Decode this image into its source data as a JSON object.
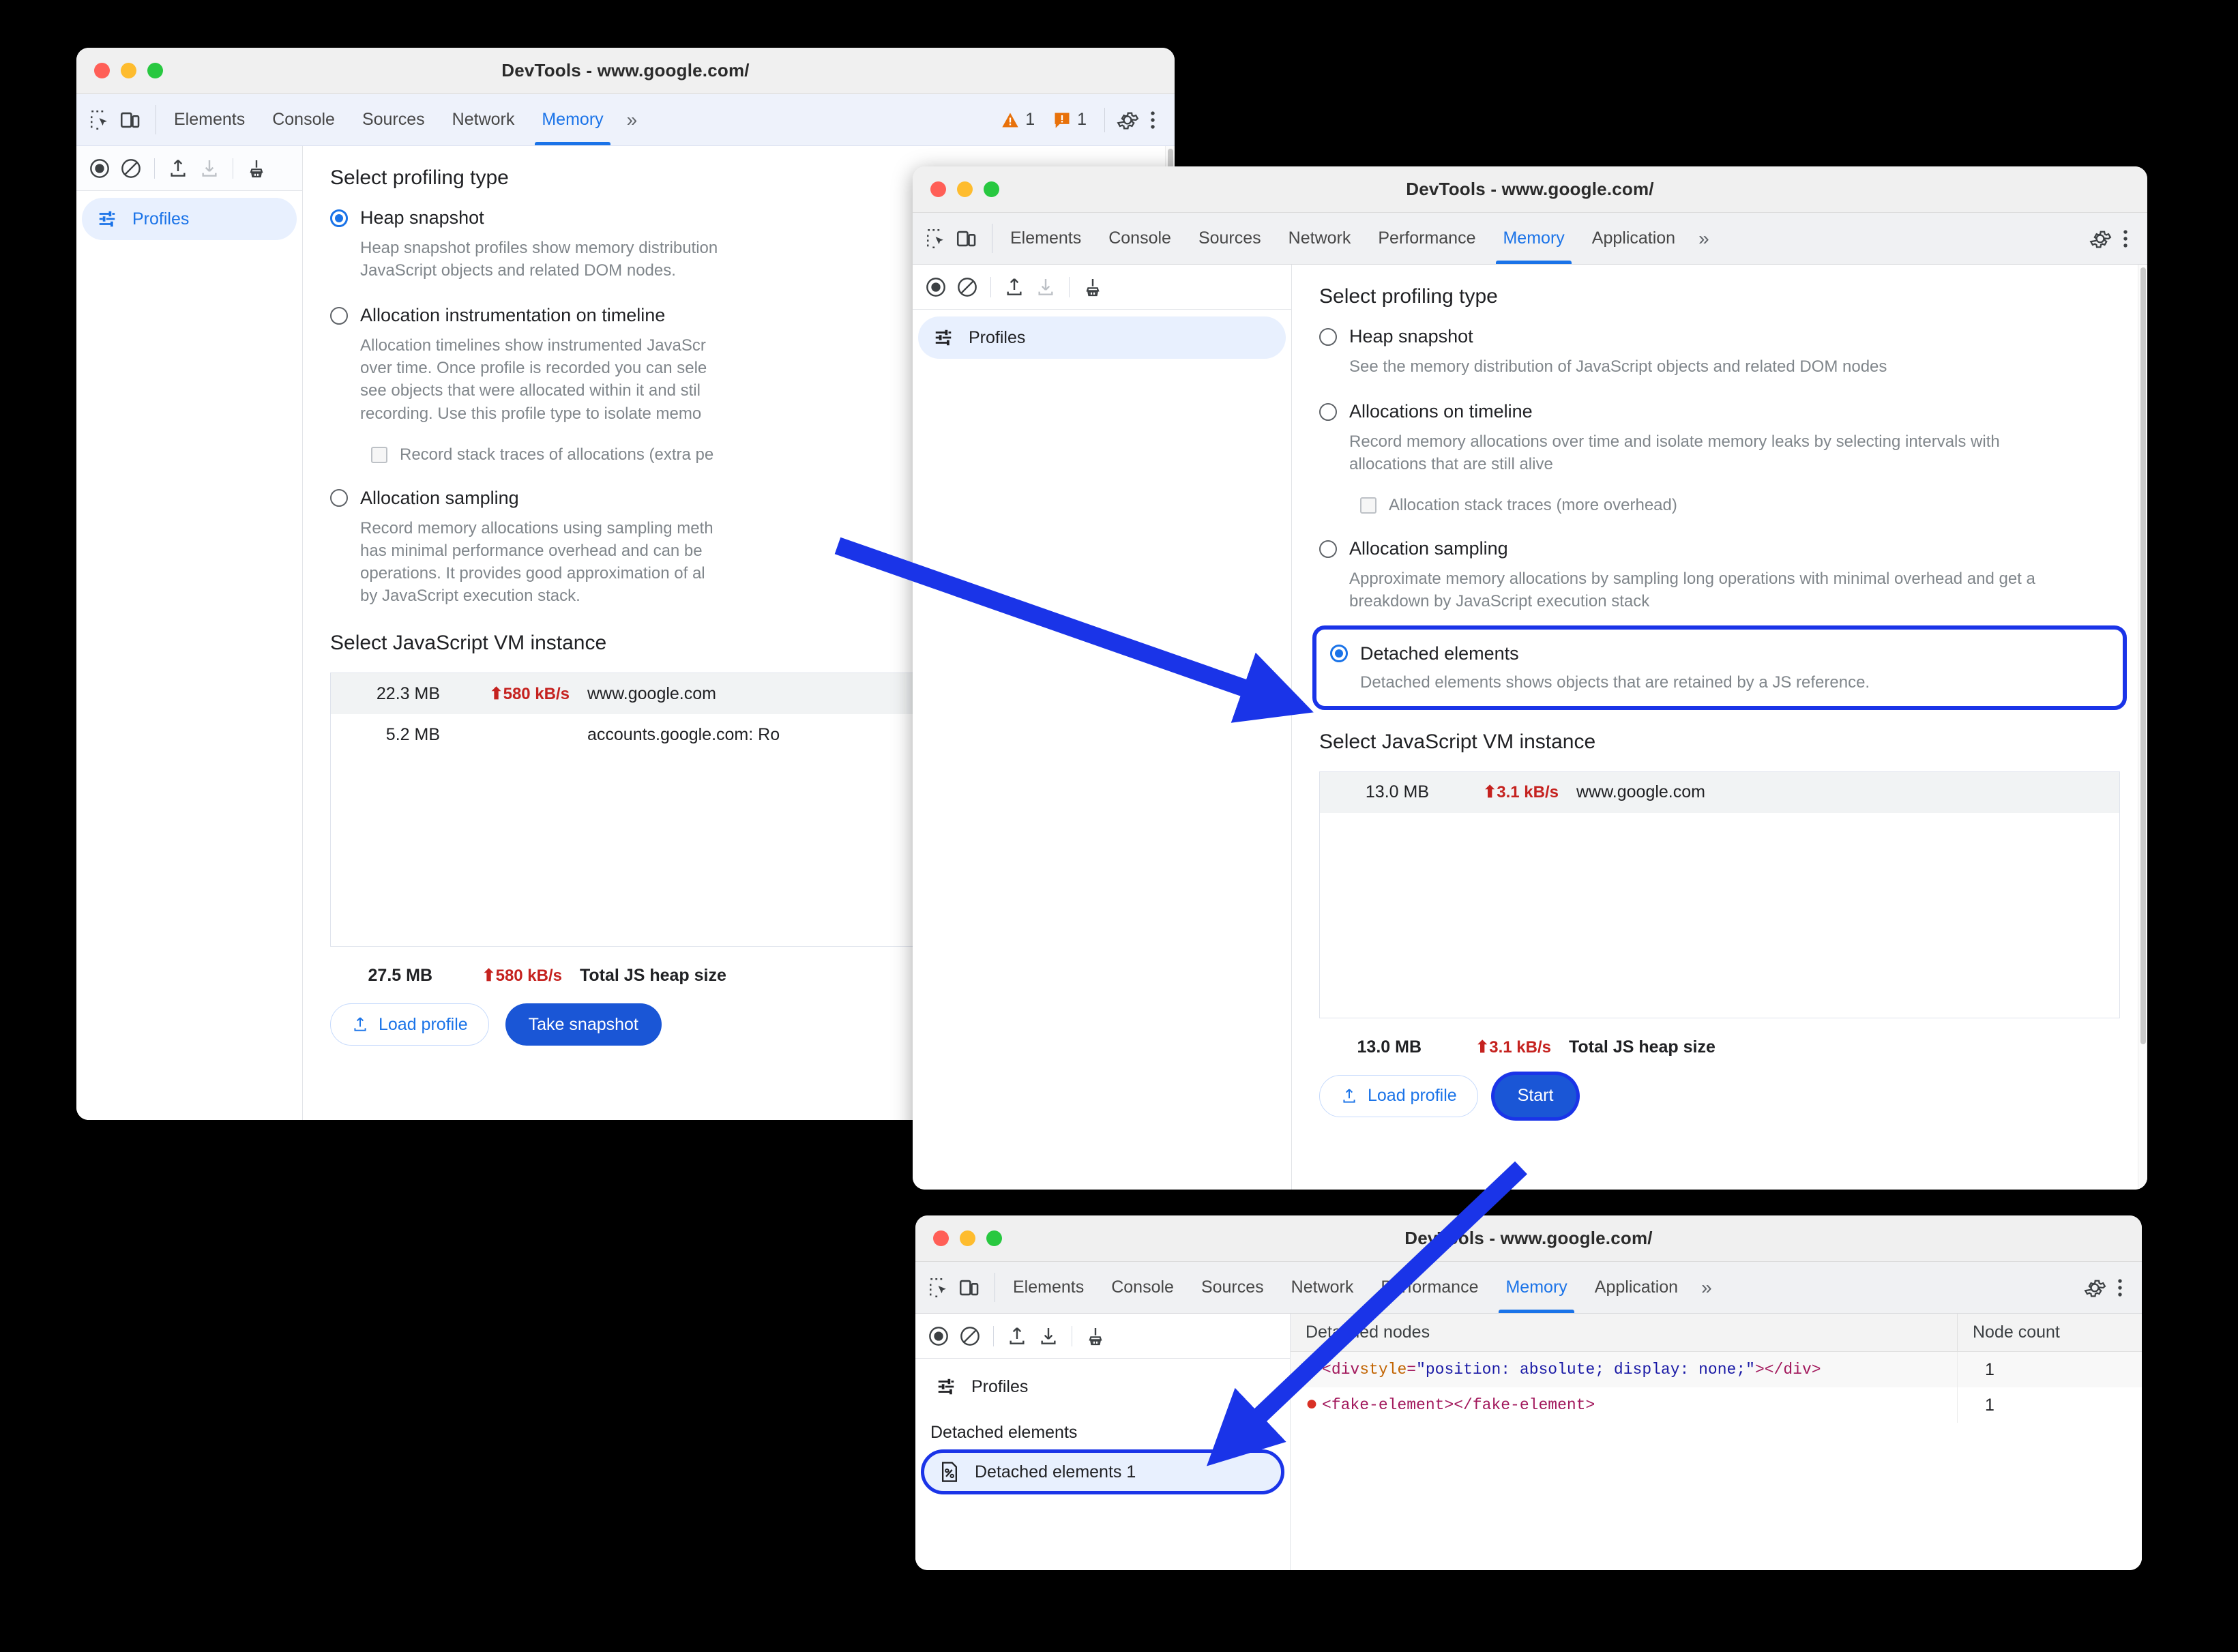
{
  "windows": [
    {
      "title": "DevTools - www.google.com/",
      "tabs": [
        "Elements",
        "Console",
        "Sources",
        "Network",
        "Memory"
      ],
      "active_tab": "Memory",
      "overflow_label": "»",
      "warning_count": "1",
      "error_count": "1",
      "sidebar": {
        "profiles_label": "Profiles"
      },
      "section_profiling": "Select profiling type",
      "options": [
        {
          "label": "Heap snapshot",
          "selected": true,
          "desc": "Heap snapshot profiles show memory distribution\nJavaScript objects and related DOM nodes."
        },
        {
          "label": "Allocation instrumentation on timeline",
          "selected": false,
          "desc": "Allocation timelines show instrumented JavaScr\nover time. Once profile is recorded you can sele\nsee objects that were allocated within it and stil\nrecording. Use this profile type to isolate memo",
          "checkbox_label": "Record stack traces of allocations (extra pe"
        },
        {
          "label": "Allocation sampling",
          "selected": false,
          "desc": "Record memory allocations using sampling meth\nhas minimal performance overhead and can be \noperations. It provides good approximation of al\nby JavaScript execution stack."
        }
      ],
      "section_vm": "Select JavaScript VM instance",
      "vm_rows": [
        {
          "size": "22.3 MB",
          "rate": "580 kB/s",
          "name": "www.google.com",
          "selected": true
        },
        {
          "size": "5.2 MB",
          "rate": "",
          "name": "accounts.google.com: Ro",
          "selected": false
        }
      ],
      "total": {
        "size": "27.5 MB",
        "rate": "580 kB/s",
        "label": "Total JS heap size"
      },
      "buttons": {
        "load": "Load profile",
        "primary": "Take snapshot"
      }
    },
    {
      "title": "DevTools - www.google.com/",
      "tabs": [
        "Elements",
        "Console",
        "Sources",
        "Network",
        "Performance",
        "Memory",
        "Application"
      ],
      "active_tab": "Memory",
      "overflow_label": "»",
      "sidebar": {
        "profiles_label": "Profiles"
      },
      "section_profiling": "Select profiling type",
      "options": [
        {
          "label": "Heap snapshot",
          "selected": false,
          "desc": "See the memory distribution of JavaScript objects and related DOM nodes"
        },
        {
          "label": "Allocations on timeline",
          "selected": false,
          "desc": "Record memory allocations over time and isolate memory leaks by selecting intervals with allocations that are still alive",
          "checkbox_label": "Allocation stack traces (more overhead)"
        },
        {
          "label": "Allocation sampling",
          "selected": false,
          "desc": "Approximate memory allocations by sampling long operations with minimal overhead and get a breakdown by JavaScript execution stack"
        },
        {
          "label": "Detached elements",
          "selected": true,
          "highlighted": true,
          "desc": "Detached elements shows objects that are retained by a JS reference."
        }
      ],
      "section_vm": "Select JavaScript VM instance",
      "vm_rows": [
        {
          "size": "13.0 MB",
          "rate": "3.1 kB/s",
          "name": "www.google.com",
          "selected": true
        }
      ],
      "total": {
        "size": "13.0 MB",
        "rate": "3.1 kB/s",
        "label": "Total JS heap size"
      },
      "buttons": {
        "load": "Load profile",
        "primary": "Start"
      }
    },
    {
      "title": "DevTools - www.google.com/",
      "tabs": [
        "Elements",
        "Console",
        "Sources",
        "Network",
        "Performance",
        "Memory",
        "Application"
      ],
      "active_tab": "Memory",
      "overflow_label": "»",
      "sidebar": {
        "profiles_label": "Profiles",
        "group_label": "Detached elements",
        "selected_item": "Detached elements 1"
      },
      "table": {
        "columns": [
          "Detached nodes",
          "Node count"
        ],
        "rows": [
          {
            "tag_open": "<div ",
            "attr": "style",
            "eq": "=",
            "value": "\"position: absolute; display: none;\"",
            "tag_close": "></div>",
            "count": "1"
          },
          {
            "tag_open": "<fake-element></fake-element>",
            "attr": "",
            "eq": "",
            "value": "",
            "tag_close": "",
            "count": "1"
          }
        ]
      }
    }
  ],
  "colors": {
    "accent_blue": "#1a73e8",
    "annotation_blue": "#1a34e8",
    "error_red": "#c5221f",
    "warning_orange": "#e8710a"
  },
  "icons": {
    "inspect": "inspect-element-icon",
    "device": "device-toolbar-icon",
    "record": "record-icon",
    "clear": "clear-icon",
    "load": "upload-icon",
    "save": "download-icon",
    "collect_garbage": "broom-icon",
    "settings": "gear-icon",
    "more": "kebab-menu-icon",
    "profiles": "sliders-icon",
    "detached_doc": "document-percent-icon"
  }
}
